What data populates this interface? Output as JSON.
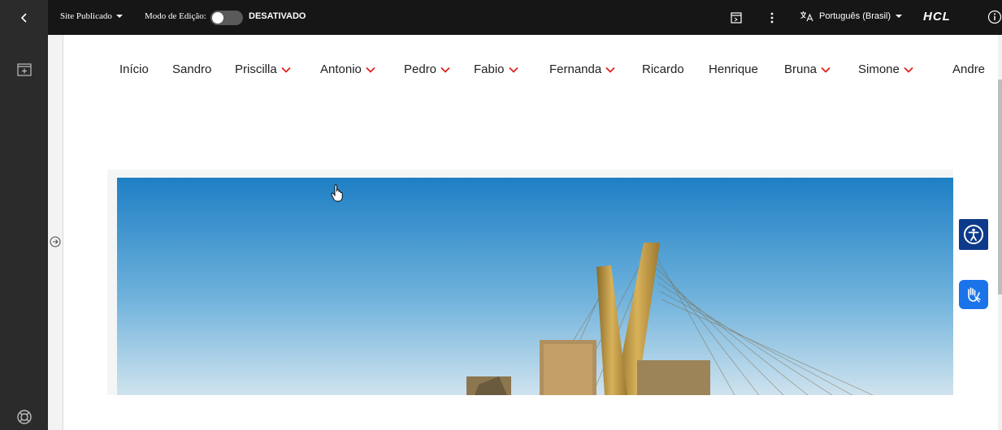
{
  "toolbar": {
    "site_status": "Site Publicado",
    "edit_mode_label": "Modo de Edição:",
    "edit_mode_state": "DESATIVADO",
    "edit_mode_on": false,
    "language": "Português (Brasil)",
    "brand": "HCL",
    "icons": [
      "back-icon",
      "caret-down-icon",
      "panel-icon",
      "kebab-icon",
      "translate-icon",
      "info-icon"
    ]
  },
  "sidebar": {
    "icons": [
      "add-page-icon",
      "help-icon"
    ]
  },
  "nav": {
    "items": [
      {
        "label": "Início",
        "has_dropdown": false
      },
      {
        "label": "Sandro",
        "has_dropdown": false
      },
      {
        "label": "Priscilla",
        "has_dropdown": true
      },
      {
        "label": "Antonio",
        "has_dropdown": true
      },
      {
        "label": "Pedro",
        "has_dropdown": true
      },
      {
        "label": "Fabio",
        "has_dropdown": true
      },
      {
        "label": "Fernanda",
        "has_dropdown": true
      },
      {
        "label": "Ricardo",
        "has_dropdown": false
      },
      {
        "label": "Henrique",
        "has_dropdown": false
      },
      {
        "label": "Bruna",
        "has_dropdown": true
      },
      {
        "label": "Simone",
        "has_dropdown": true
      },
      {
        "label": "Andre",
        "has_dropdown": false
      }
    ]
  },
  "hero": {
    "icon": "bridge-photo"
  },
  "floating": {
    "icons": [
      "accessibility-icon",
      "sign-language-icon"
    ]
  },
  "colors": {
    "toolbar_bg": "#161616",
    "sidebar_bg": "#2b2b2b",
    "accent_red": "#e0201b",
    "a11y_blue": "#0d3a8a",
    "libras_blue": "#1a73e8",
    "sky_top": "#1e7fc4",
    "sky_bottom": "#cfe3ee"
  }
}
